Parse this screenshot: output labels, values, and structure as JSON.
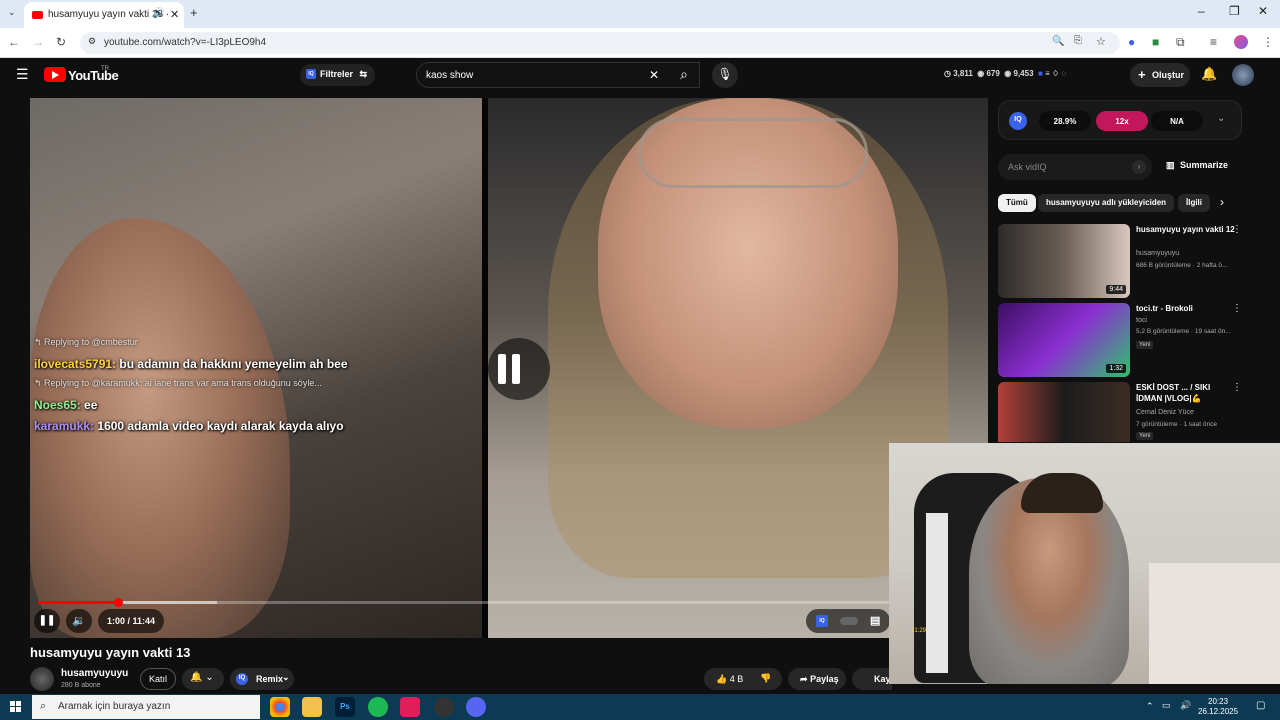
{
  "browser": {
    "tab_title": "husamyuyu yayın vakti 13 ·",
    "url": "youtube.com/watch?v=-LI3pLEO9h4",
    "icons": [
      "back-icon",
      "forward-icon",
      "reload-icon",
      "zoom-icon",
      "star-icon",
      "extensions-icon",
      "profile-icon"
    ]
  },
  "yt": {
    "wordmark": "YouTube",
    "region": "TR",
    "filters": "Filtreler",
    "search_value": "kaos show",
    "stats": {
      "s1": "3,811",
      "s2": "679",
      "s3": "9,453"
    },
    "create": "Oluştur"
  },
  "player": {
    "time": "1:00 / 11:44",
    "progress_fraction": 0.085,
    "buffer_fraction": 0.19,
    "chat": [
      {
        "reply": "Replying to @cmbestur"
      },
      {
        "user": "ilovecats5791:",
        "msg": "bu adamın da hakkını yemeyelim ah bee"
      },
      {
        "reply": "Replying to @karamukk: ai iane trans var ama trans olduğunu söyle..."
      },
      {
        "user": "Noes65:",
        "msg": "ee"
      },
      {
        "user": "karamukk:",
        "msg": "1600 adamla video kaydı alarak kayda alıyo"
      }
    ]
  },
  "video": {
    "title": "husamyuyu yayın vakti 13",
    "channel": "husamyuyuyu",
    "subs": "280 B abone",
    "join": "Katıl",
    "remix": "Remix",
    "remix_badge": "IQ",
    "likes": "4 B",
    "share": "Paylaş",
    "save": "Kay"
  },
  "sidebar": {
    "iq_logo": "IQ",
    "iq_pills": [
      "28.9%",
      "12x",
      "N/A"
    ],
    "ask_placeholder": "Ask vidIQ",
    "summarize": "Summarize",
    "chips": [
      "Tümü",
      "husamyuyuyu adlı yükleyiciden",
      "İlgili"
    ],
    "recs": [
      {
        "title": "husamyuyu yayın vakti 12",
        "channel": "husamyuyuyu",
        "meta": "686 B görüntüleme · 2 hafta ö...",
        "duration": "9:44",
        "new": ""
      },
      {
        "title": "toci.tr - Brokoli",
        "channel": "toci",
        "meta": "5,2 B görüntüleme · 19 saat ön...",
        "duration": "1:32",
        "new": "Yeni"
      },
      {
        "title": "ESKİ DOST ... / SIKI İDMAN |VLOG|💪",
        "channel": "Cemal Deniz Yüce",
        "meta": "7 görüntüleme · 1 saat önce",
        "duration": "",
        "new": "Yeni"
      }
    ]
  },
  "webcam": {
    "sticker": "21:29"
  },
  "taskbar": {
    "search_placeholder": "Aramak için buraya yazın",
    "time": "20:23",
    "date": "26.12.2025"
  }
}
